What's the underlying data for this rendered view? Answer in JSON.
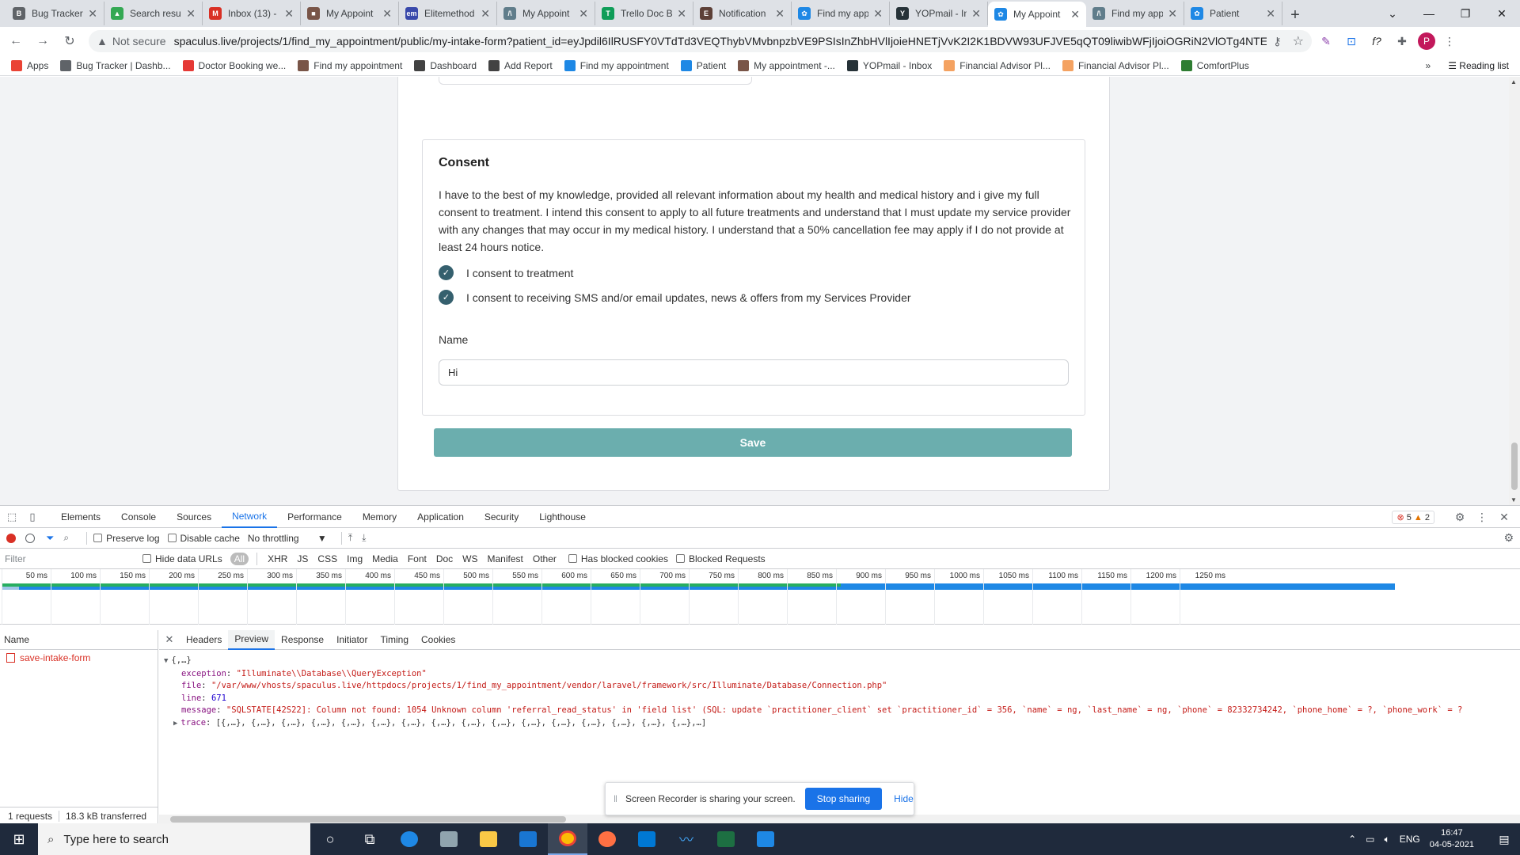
{
  "browser": {
    "tabs": [
      {
        "title": "Bug Tracker",
        "color": "#5f6368",
        "glyph": "B",
        "active": false
      },
      {
        "title": "Search resu",
        "color": "#34a853",
        "glyph": "▲",
        "active": false
      },
      {
        "title": "Inbox (13) -",
        "color": "#d93025",
        "glyph": "M",
        "active": false
      },
      {
        "title": "My Appoint",
        "color": "#795548",
        "glyph": "■",
        "active": false
      },
      {
        "title": "Elitemethod",
        "color": "#3949ab",
        "glyph": "em",
        "active": false
      },
      {
        "title": "My Appoint",
        "color": "#607d8b",
        "glyph": "/\\",
        "active": false
      },
      {
        "title": "Trello Doc B",
        "color": "#0f9d58",
        "glyph": "T",
        "active": false
      },
      {
        "title": "Notification",
        "color": "#5d4037",
        "glyph": "E",
        "active": false
      },
      {
        "title": "Find my app",
        "color": "#1e88e5",
        "glyph": "✿",
        "active": false
      },
      {
        "title": "YOPmail - In",
        "color": "#263238",
        "glyph": "Y",
        "active": false
      },
      {
        "title": "My Appoint",
        "color": "#1e88e5",
        "glyph": "✿",
        "active": true
      },
      {
        "title": "Find my app",
        "color": "#607d8b",
        "glyph": "/\\",
        "active": false
      },
      {
        "title": "Patient",
        "color": "#1e88e5",
        "glyph": "✿",
        "active": false
      }
    ],
    "new_tab": "+",
    "not_secure": "Not secure",
    "url": "spaculus.live/projects/1/find_my_appointment/public/my-intake-form?patient_id=eyJpdil6IlRUSFY0VTdTd3VEQThybVMvbnpzbVE9PSIsInZhbHVlIjoieHNETjVvK2I2K1BDVW93UFJVE5qQT09liwibWFjIjoiOGRiN2VlOTg4NTE2YTI4NTQ...",
    "avatar_letter": "P",
    "bookmarks": [
      {
        "label": "Apps",
        "color": "#ea4335"
      },
      {
        "label": "Bug Tracker | Dashb...",
        "color": "#5f6368"
      },
      {
        "label": "Doctor Booking we...",
        "color": "#e53935"
      },
      {
        "label": "Find my appointment",
        "color": "#795548"
      },
      {
        "label": "Dashboard",
        "color": "#424242"
      },
      {
        "label": "Add Report",
        "color": "#424242"
      },
      {
        "label": "Find my appointment",
        "color": "#1e88e5"
      },
      {
        "label": "Patient",
        "color": "#1e88e5"
      },
      {
        "label": "My appointment -...",
        "color": "#795548"
      },
      {
        "label": "YOPmail - Inbox",
        "color": "#263238"
      },
      {
        "label": "Financial Advisor Pl...",
        "color": "#f4a261"
      },
      {
        "label": "Financial Advisor Pl...",
        "color": "#f4a261"
      },
      {
        "label": "ComfortPlus",
        "color": "#2e7d32"
      }
    ],
    "bookmarks_more": "»",
    "reading_list": "Reading list"
  },
  "consent": {
    "title": "Consent",
    "text": "I have to the best of my knowledge, provided all relevant information about my health and medical history and i give my full consent to treatment. I intend this consent to apply to all future treatments and understand that I must update my service provider with any changes that may occur in my medical history. I understand that a 50% cancellation fee may apply if I do not provide at least 24 hours notice.",
    "checks": [
      {
        "label": "I consent to treatment",
        "checked": true
      },
      {
        "label": "I consent to receiving SMS and/or email updates, news & offers from my Services Provider",
        "checked": true
      }
    ],
    "name_label": "Name",
    "name_value": "Hi",
    "save_label": "Save"
  },
  "devtools": {
    "tabs": [
      "Elements",
      "Console",
      "Sources",
      "Network",
      "Performance",
      "Memory",
      "Application",
      "Security",
      "Lighthouse"
    ],
    "active_tab": "Network",
    "errors": "5",
    "warnings": "2",
    "toolbar": {
      "preserve_log": "Preserve log",
      "disable_cache": "Disable cache",
      "throttling": "No throttling"
    },
    "filter": {
      "placeholder": "Filter",
      "hide_data_urls": "Hide data URLs",
      "types": [
        "All",
        "XHR",
        "JS",
        "CSS",
        "Img",
        "Media",
        "Font",
        "Doc",
        "WS",
        "Manifest",
        "Other"
      ],
      "has_blocked_cookies": "Has blocked cookies",
      "blocked_requests": "Blocked Requests"
    },
    "timeline_ticks": [
      "50 ms",
      "100 ms",
      "150 ms",
      "200 ms",
      "250 ms",
      "300 ms",
      "350 ms",
      "400 ms",
      "450 ms",
      "500 ms",
      "550 ms",
      "600 ms",
      "650 ms",
      "700 ms",
      "750 ms",
      "800 ms",
      "850 ms",
      "900 ms",
      "950 ms",
      "1000 ms",
      "1050 ms",
      "1100 ms",
      "1150 ms",
      "1200 ms",
      "1250 ms"
    ],
    "name_header": "Name",
    "request_name": "save-intake-form",
    "footer_requests": "1 requests",
    "footer_transferred": "18.3 kB transferred",
    "detail_tabs": [
      "Headers",
      "Preview",
      "Response",
      "Initiator",
      "Timing",
      "Cookies"
    ],
    "active_detail_tab": "Preview",
    "preview": {
      "root": "{,…}",
      "exception_key": "exception",
      "exception_val": "\"Illuminate\\\\Database\\\\QueryException\"",
      "file_key": "file",
      "file_val": "\"/var/www/vhosts/spaculus.live/httpdocs/projects/1/find_my_appointment/vendor/laravel/framework/src/Illuminate/Database/Connection.php\"",
      "line_key": "line",
      "line_val": "671",
      "message_key": "message",
      "message_val": "\"SQLSTATE[42S22]: Column not found: 1054 Unknown column 'referral_read_status' in 'field list' (SQL: update `practitioner_client` set `practitioner_id` = 356, `name` = ng, `last_name` = ng, `phone` = 82332734242, `phone_home` = ?, `phone_work` = ?",
      "trace_key": "trace",
      "trace_val": "[{,…}, {,…}, {,…}, {,…}, {,…}, {,…}, {,…}, {,…}, {,…}, {,…}, {,…}, {,…}, {,…}, {,…}, {,…}, {,…},…]"
    }
  },
  "share_bar": {
    "text": "Screen Recorder is sharing your screen.",
    "stop": "Stop sharing",
    "hide": "Hide"
  },
  "taskbar": {
    "search_placeholder": "Type here to search",
    "language": "ENG",
    "time": "16:47",
    "date": "04-05-2021"
  }
}
